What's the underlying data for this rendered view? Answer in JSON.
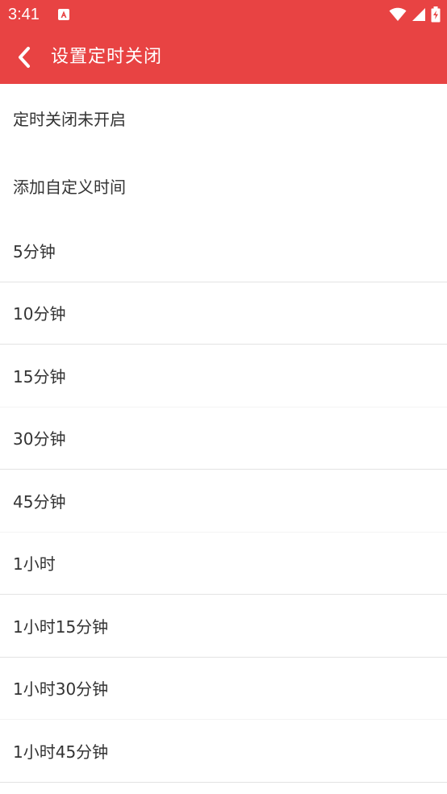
{
  "status_bar": {
    "time": "3:41",
    "notification_icon": "app-notification-icon",
    "icons": [
      "wifi-icon",
      "cell-signal-icon",
      "battery-charging-icon"
    ]
  },
  "toolbar": {
    "title": "设置定时关闭",
    "back_icon": "chevron-left-icon"
  },
  "colors": {
    "accent": "#e84343",
    "text": "#333333",
    "divider": "#e3e3e3",
    "background": "#ffffff"
  },
  "top_items": [
    {
      "label": "定时关闭未开启"
    },
    {
      "label": "添加自定义时间"
    }
  ],
  "timer_options": [
    {
      "label": "5分钟"
    },
    {
      "label": "10分钟"
    },
    {
      "label": "15分钟"
    },
    {
      "label": "30分钟"
    },
    {
      "label": "45分钟"
    },
    {
      "label": "1小时"
    },
    {
      "label": "1小时15分钟"
    },
    {
      "label": "1小时30分钟"
    },
    {
      "label": "1小时45分钟"
    }
  ]
}
